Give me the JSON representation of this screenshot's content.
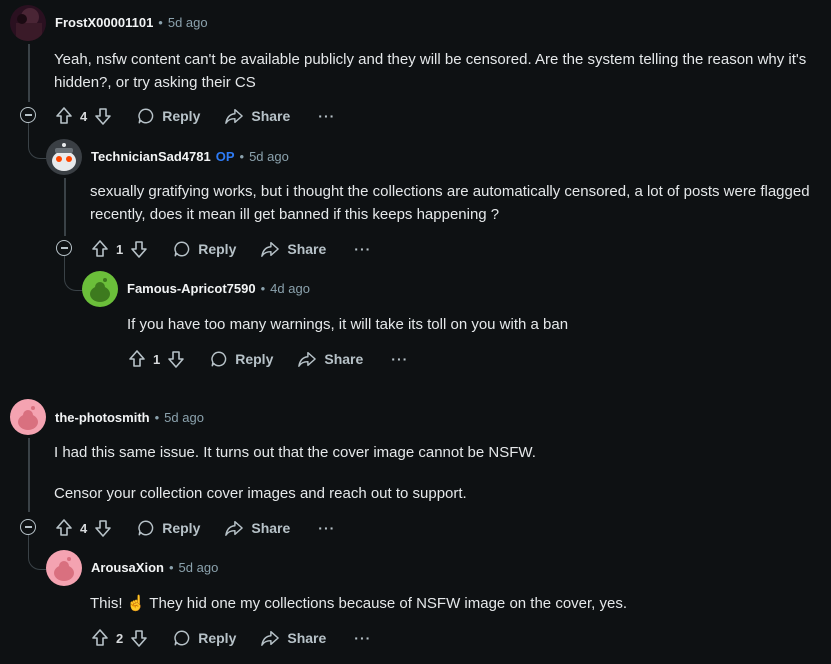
{
  "comments": [
    {
      "author": "FrostX00001101",
      "time": "5d ago",
      "body": [
        "Yeah, nsfw content can't be available publicly and they will be censored. Are the system telling the reason why it's hidden?, or try asking their CS"
      ],
      "votes": "4"
    },
    {
      "author": "TechnicianSad4781",
      "op_badge": "OP",
      "time": "5d ago",
      "body": [
        "sexually gratifying works, but i thought the collections are automatically censored, a lot of posts were flagged recently, does it mean ill get banned if this keeps happening ?"
      ],
      "votes": "1"
    },
    {
      "author": "Famous-Apricot7590",
      "time": "4d ago",
      "body": [
        "If you have too many warnings, it will take its toll on you with a ban"
      ],
      "votes": "1"
    },
    {
      "author": "the-photosmith",
      "time": "5d ago",
      "body": [
        "I had this same issue. It turns out that the cover image cannot be NSFW.",
        "Censor your collection cover images and reach out to support."
      ],
      "votes": "4"
    },
    {
      "author": "ArousaXion",
      "time": "5d ago",
      "body_prefix": "This!",
      "emoji": "☝️",
      "body_suffix": "They hid one my collections because of NSFW image on the cover, yes.",
      "votes": "2"
    }
  ],
  "labels": {
    "reply": "Reply",
    "share": "Share",
    "more": "···",
    "dot": "•"
  },
  "colors": {
    "background": "#0e1113",
    "op": "#2e7cf6",
    "thread_line": "#3a4247",
    "avatar_green": "#6bbf3a",
    "avatar_pink": "#f4a3b1"
  },
  "icons": [
    "upvote-icon",
    "downvote-icon",
    "reply-bubble-icon",
    "share-arrow-icon",
    "collapse-minus-icon"
  ]
}
